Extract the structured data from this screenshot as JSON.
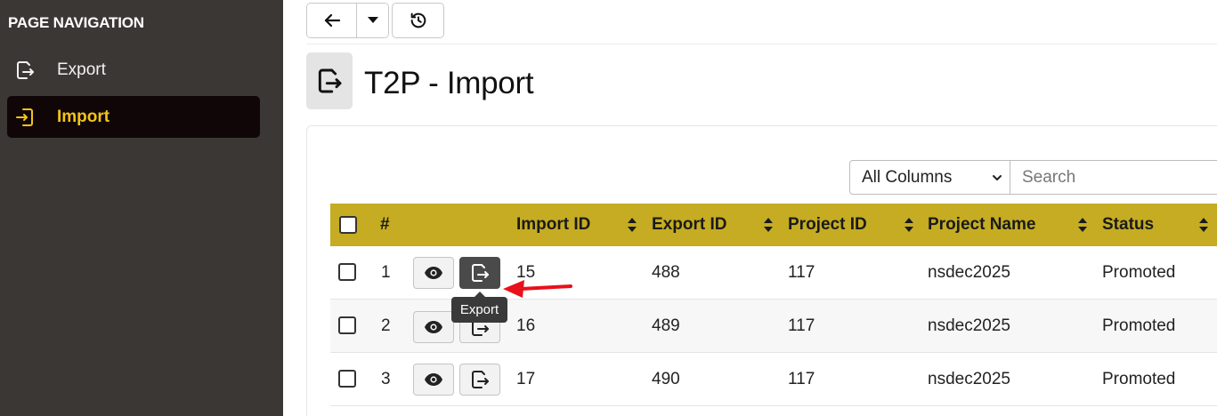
{
  "sidebar": {
    "title": "PAGE NAVIGATION",
    "items": [
      {
        "label": "Export",
        "icon": "export-icon",
        "active": false
      },
      {
        "label": "Import",
        "icon": "import-icon",
        "active": true
      }
    ]
  },
  "toolbar": {
    "back_icon": "arrow-left-icon",
    "dropdown_icon": "caret-down-icon",
    "history_icon": "history-icon"
  },
  "page": {
    "title": "T2P - Import",
    "icon": "export-icon"
  },
  "search": {
    "column_filter": "All Columns",
    "placeholder": "Search"
  },
  "table": {
    "columns": [
      "#",
      "Import ID",
      "Export ID",
      "Project ID",
      "Project Name",
      "Status"
    ],
    "rows": [
      {
        "num": "1",
        "import_id": "15",
        "export_id": "488",
        "project_id": "117",
        "project_name": "nsdec2025",
        "status": "Promoted"
      },
      {
        "num": "2",
        "import_id": "16",
        "export_id": "489",
        "project_id": "117",
        "project_name": "nsdec2025",
        "status": "Promoted"
      },
      {
        "num": "3",
        "import_id": "17",
        "export_id": "490",
        "project_id": "117",
        "project_name": "nsdec2025",
        "status": "Promoted"
      }
    ]
  },
  "tooltip": {
    "text": "Export"
  },
  "colors": {
    "sidebar_bg": "#3b3735",
    "active_item_bg": "#100608",
    "accent": "#f2c418",
    "header_bg": "#c5ac22",
    "annotation_arrow": "#e8101a"
  }
}
